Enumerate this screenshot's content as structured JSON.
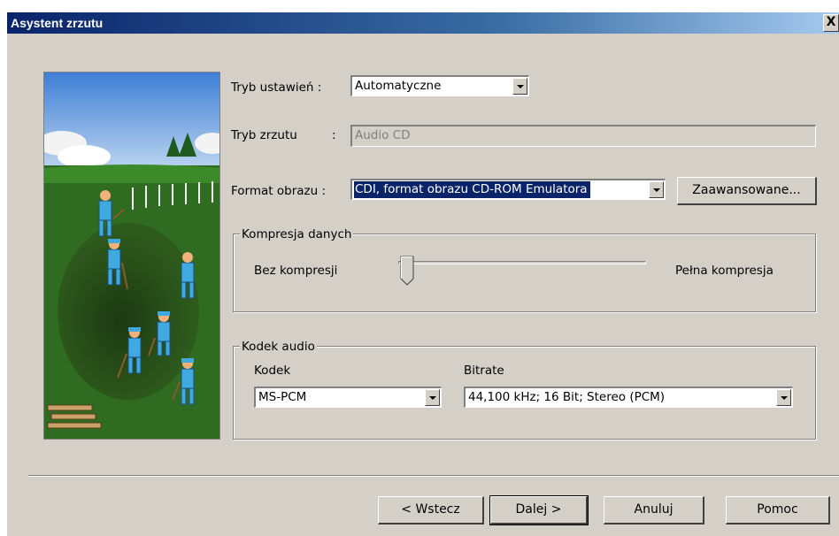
{
  "window": {
    "title": "Asystent zrzutu",
    "close_symbol": "X"
  },
  "fields": {
    "mode_label": "Tryb ustawień :",
    "mode_value": "Automatyczne",
    "dump_label": "Tryb zrzutu",
    "dump_colon": ":",
    "dump_value": "Audio CD",
    "format_label": "Format obrazu :",
    "format_value": "CDI, format obrazu CD-ROM Emulatora",
    "advanced_button": "Zaawansowane..."
  },
  "compression": {
    "group_label": "Kompresja danych",
    "min_label": "Bez kompresji",
    "max_label": "Pełna kompresja",
    "level": 0
  },
  "audio": {
    "group_label": "Kodek audio",
    "codec_label": "Kodek",
    "codec_value": "MS-PCM",
    "bitrate_label": "Bitrate",
    "bitrate_value": "44,100 kHz; 16 Bit; Stereo (PCM)"
  },
  "buttons": {
    "back": "< Wstecz",
    "next": "Dalej >",
    "cancel": "Anuluj",
    "help": "Pomoc"
  }
}
